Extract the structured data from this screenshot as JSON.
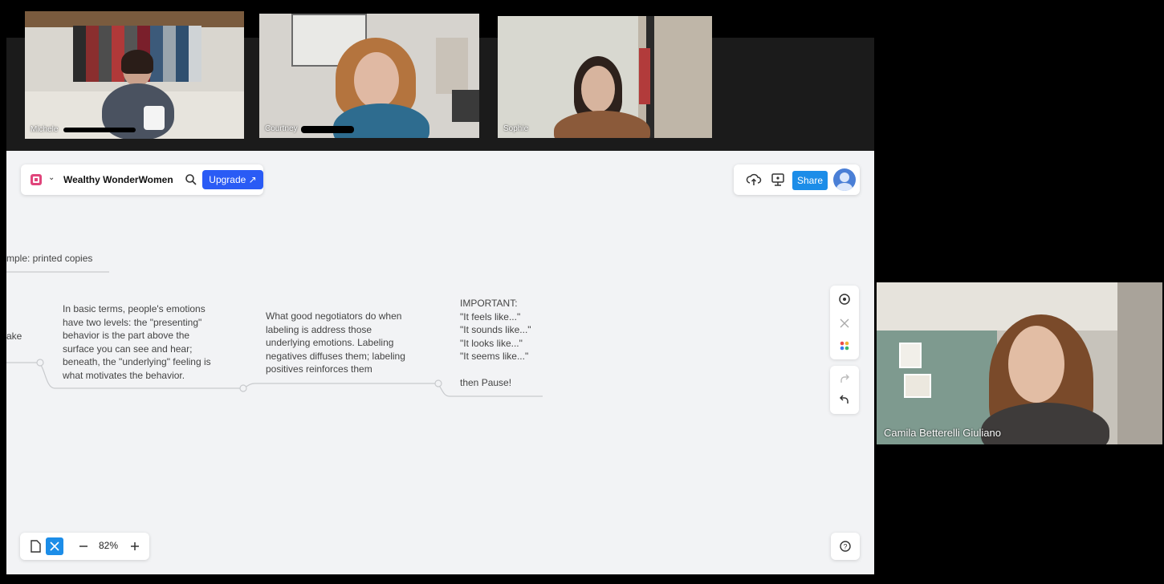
{
  "participants": [
    {
      "name": "Michele"
    },
    {
      "name": "Courtney"
    },
    {
      "name": "Sophie"
    },
    {
      "name": "Camila Betterelli Giuliano"
    }
  ],
  "board": {
    "title": "Wealthy WonderWomen",
    "upgrade_label": "Upgrade ↗",
    "share_label": "Share",
    "zoom": "82%",
    "icons": {
      "logo": "board-logo-icon",
      "caret": "chevron-down-icon",
      "search": "search-icon",
      "cloud": "cloud-upload-icon",
      "present": "present-icon",
      "help": "help-icon"
    }
  },
  "mindmap": {
    "partial_top": "mple: printed copies",
    "partial_left": "ake",
    "node_1": "In basic terms, people's emotions\nhave two levels: the \"presenting\"\nbehavior is the part above the\nsurface you can see and hear;\nbeneath, the \"underlying\" feeling is\nwhat motivates the behavior.",
    "node_2": "What good negotiators do when\nlabeling is address those\nunderlying emotions. Labeling\nnegatives diffuses them; labeling\npositives reinforces them",
    "node_3": "IMPORTANT:\n\"It feels like...\"\n\"It sounds like...\"\n\"It looks like...\"\n\"It seems like...\"\n\nthen Pause!"
  },
  "colors": {
    "upgrade": "#2a5bf5",
    "share": "#1c8de8",
    "logo": "#e0457b",
    "board_bg": "#f2f3f5"
  }
}
